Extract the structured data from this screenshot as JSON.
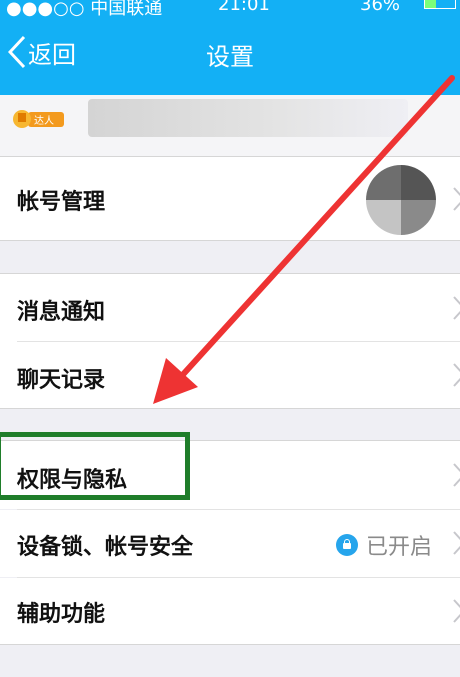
{
  "status_bar": {
    "carrier": "●●●○○ 中国联通 ",
    "time": "21:01",
    "battery": "36%"
  },
  "header": {
    "back_label": "返回",
    "title": "设置"
  },
  "profile": {
    "badge_text": "达人"
  },
  "settings": [
    {
      "label": "帐号管理"
    },
    {
      "label": "消息通知"
    },
    {
      "label": "聊天记录"
    },
    {
      "label": "权限与隐私"
    },
    {
      "label": "设备锁、帐号安全",
      "status": "已开启"
    },
    {
      "label": "辅助功能"
    }
  ],
  "colors": {
    "header_bg": "#13b0f5",
    "highlight_border": "#1f7d2a",
    "arrow": "#ee3333",
    "lock_icon": "#26a5ec"
  }
}
